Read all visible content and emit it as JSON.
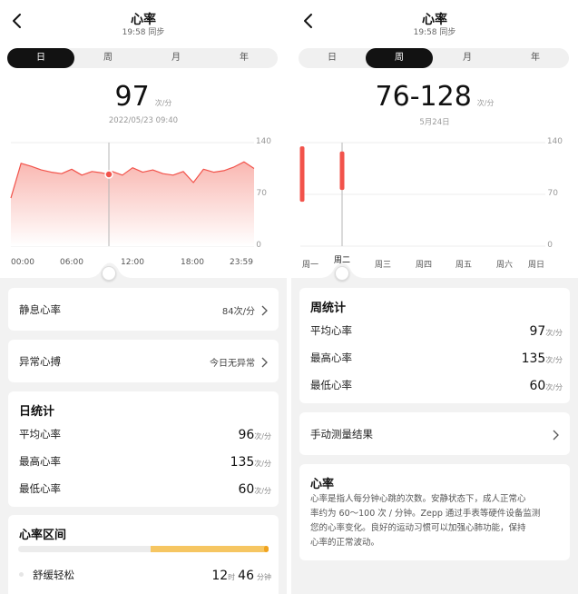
{
  "left": {
    "header": {
      "title": "心率",
      "subtitle": "19:58 同步"
    },
    "tabs": [
      {
        "label": "日",
        "active": true
      },
      {
        "label": "周"
      },
      {
        "label": "月"
      },
      {
        "label": "年"
      }
    ],
    "reading": {
      "value": "97",
      "unit": "次/分",
      "datetime": "2022/05/23 09:40"
    },
    "chart": {
      "y_labels": [
        "140",
        "70",
        "0"
      ],
      "x_labels": [
        "00:00",
        "06:00",
        "12:00",
        "18:00",
        "23:59"
      ]
    },
    "resting": {
      "label": "静息心率",
      "value": "84次/分"
    },
    "abnormal": {
      "label": "异常心搏",
      "value": "今日无异常"
    },
    "day_stats": {
      "title": "日统计",
      "rows": [
        {
          "label": "平均心率",
          "value": "96",
          "unit": "次/分"
        },
        {
          "label": "最高心率",
          "value": "135",
          "unit": "次/分"
        },
        {
          "label": "最低心率",
          "value": "60",
          "unit": "次/分"
        }
      ]
    },
    "zones": {
      "title": "心率区间",
      "item": {
        "label": "舒缓轻松",
        "hours": "12",
        "hours_unit": "时",
        "minutes": "46",
        "minutes_unit": "分钟"
      }
    }
  },
  "right": {
    "header": {
      "title": "心率",
      "subtitle": "19:58 同步"
    },
    "tabs": [
      {
        "label": "日"
      },
      {
        "label": "周",
        "active": true
      },
      {
        "label": "月"
      },
      {
        "label": "年"
      }
    ],
    "reading": {
      "value": "76-128",
      "unit": "次/分",
      "date": "5月24日"
    },
    "chart": {
      "y_labels": [
        "140",
        "70",
        "0"
      ],
      "x_labels": [
        "周一",
        "周二",
        "周三",
        "周四",
        "周五",
        "周六",
        "周日"
      ]
    },
    "week_stats": {
      "title": "周统计",
      "rows": [
        {
          "label": "平均心率",
          "value": "97",
          "unit": "次/分"
        },
        {
          "label": "最高心率",
          "value": "135",
          "unit": "次/分"
        },
        {
          "label": "最低心率",
          "value": "60",
          "unit": "次/分"
        }
      ]
    },
    "manual": {
      "label": "手动测量结果"
    },
    "info": {
      "title": "心率",
      "lines": [
        "心率是指人每分钟心跳的次数。安静状态下，成人正常心",
        "率约为 60～100 次 / 分钟。Zepp 通过手表等硬件设备监测",
        "您的心率变化。良好的运动习惯可以加强心肺功能，保持",
        "心率的正常波动。"
      ]
    }
  },
  "chart_data": [
    {
      "type": "area",
      "ylim": [
        0,
        140
      ],
      "x": [
        "00:00",
        "01:00",
        "02:00",
        "03:00",
        "04:00",
        "05:00",
        "06:00",
        "07:00",
        "08:00",
        "09:00",
        "09:40",
        "10:00",
        "11:00",
        "12:00",
        "13:00",
        "14:00",
        "15:00",
        "16:00",
        "17:00",
        "18:00",
        "19:00",
        "20:00",
        "21:00",
        "22:00",
        "23:00",
        "23:59"
      ],
      "values": [
        65,
        112,
        108,
        103,
        100,
        98,
        104,
        96,
        101,
        99,
        97,
        101,
        96,
        106,
        100,
        103,
        98,
        96,
        101,
        86,
        104,
        100,
        102,
        107,
        114,
        105
      ],
      "highlight": {
        "x": "09:40",
        "value": 97
      }
    },
    {
      "type": "bar",
      "categories": [
        "周一",
        "周二",
        "周三",
        "周四",
        "周五",
        "周六",
        "周日"
      ],
      "ranges": [
        [
          60,
          135
        ],
        [
          76,
          128
        ],
        null,
        null,
        null,
        null,
        null
      ],
      "selected": "周二",
      "ylim": [
        0,
        140
      ]
    }
  ],
  "colors": {
    "accent": "#f2534b",
    "fill_top": "#f9b7b1",
    "zone": "#f6c662",
    "tab_active": "#121212"
  }
}
